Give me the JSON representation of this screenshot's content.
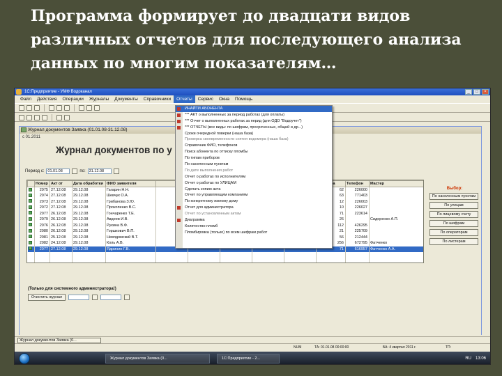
{
  "slide": {
    "title": "Программа формирует до двадцати видов\nразличных отчетов для последующего анализа\nданных по многим показателям…"
  },
  "app": {
    "title": "1С:Предприятие - УМФ Водоканал",
    "menu": [
      "Файл",
      "Действия",
      "Операции",
      "Журналы",
      "Документы",
      "Справочники",
      "Отчеты",
      "Сервис",
      "Окна",
      "Помощь"
    ],
    "active_menu_index": 6
  },
  "docwin": {
    "title": "Журнал документов Заявка (01.01.08-31.12.08)",
    "date": "с 01.2011",
    "heading": "Журнал документов по у",
    "period_label": "Период с:",
    "period_from": "01.01.08",
    "period_to_label": "по:",
    "period_to": "31.12.08"
  },
  "grid": {
    "columns": [
      "",
      "Номер",
      "Акт от",
      "Дата обработки",
      "ФИО заявителя",
      "",
      "",
      "",
      "",
      "",
      "Квартира",
      "Телефон",
      "Мастер"
    ],
    "rows": [
      [
        "2075",
        "27.12.08",
        "29.12.08",
        "Гагарин Н.Н.",
        "62",
        "226000",
        ""
      ],
      [
        "2074",
        "27.12.08",
        "29.12.08",
        "Шевчук О.А.",
        "63",
        "771403",
        ""
      ],
      [
        "2073",
        "27.12.08",
        "29.12.08",
        "Грибанова З.Ю.",
        "12",
        "226003",
        ""
      ],
      [
        "2072",
        "27.12.08",
        "29.12.08",
        "Прокопенко В.С.",
        "10",
        "226027",
        ""
      ],
      [
        "2077",
        "26.12.08",
        "29.12.08",
        "Гончаренко Т.Е.",
        "71",
        "223614",
        ""
      ],
      [
        "2079",
        "26.12.08",
        "29.12.08",
        "Авдеев И.В.",
        "26",
        "",
        "Сидоренко А.П."
      ],
      [
        "2076",
        "26.12.08",
        "29.12.08",
        "Рукина В.Ф.",
        "112",
        "426295",
        ""
      ],
      [
        "2080",
        "26.12.08",
        "29.12.08",
        "Горшкович В.П.",
        "21",
        "225709",
        ""
      ],
      [
        "2081",
        "25.12.08",
        "29.12.08",
        "Невядомский В.Т.",
        "56",
        "212444",
        ""
      ],
      [
        "2082",
        "24.12.08",
        "29.12.08",
        "Коль А.В.",
        "256",
        "672795",
        "Фатченко"
      ],
      [
        "2077",
        "27.12.08",
        "29.12.08",
        "Ядринин Г.В.",
        "71",
        "616957",
        "Фатченко А.А."
      ]
    ],
    "selected_row": 10
  },
  "side": {
    "label": "Выбор:",
    "buttons": [
      "По населенным пунктам",
      "По улицам",
      "По лицевому счету",
      "По шифрам",
      "По операторам",
      "По листерам"
    ]
  },
  "admin": {
    "label": "(Только для системного администратора!)",
    "clear_button": "Очистить журнал"
  },
  "reports_menu": {
    "items": [
      {
        "label": "ИНАЙТИ АБОНЕНТА",
        "icon": true
      },
      {
        "label": "*** АКТ о выполненных за период работах (для оплаты)",
        "icon": true
      },
      {
        "label": "*** Отчет о выполненных работах за перид (для ОДО \"Водоучет\")",
        "icon": true
      },
      {
        "label": "*** ОТЧЕТЫ (все виды: по шифрам, просроченные, общий и др...)",
        "icon": true
      },
      {
        "label": "Сроки очередной поверки (наша база)"
      },
      {
        "label": "Проверка своевременности снятия водомера (наша база)",
        "dim": true
      },
      {
        "label": "Справочник ФИО, телефонов"
      },
      {
        "label": "Поиск абонента по оттиску пломбы"
      },
      {
        "label": "По типам приборов"
      },
      {
        "label": "По населенным пунктам"
      },
      {
        "label": "По дате выполнения работ",
        "dim": true
      },
      {
        "label": "Отчет о работах по исполнителям"
      },
      {
        "label": "Отчет о работах по УЛИЦАМ"
      },
      {
        "label": "Сделать копию акта"
      },
      {
        "label": "Отчет по управляющим компаниям"
      },
      {
        "label": "По конкретному жилому дому"
      },
      {
        "label": "Отчет для администратора",
        "icon": true
      },
      {
        "label": "Отчет по установленным актам",
        "dim": true
      },
      {
        "label": "Диаграмма",
        "icon": true
      },
      {
        "label": "Количество пломб"
      },
      {
        "label": "Пломбировка (только) по всем шифрам работ"
      }
    ]
  },
  "docstrip": {
    "tab": "Журнал документов Заявка (0..."
  },
  "status": {
    "items": [
      "NUM",
      "ТА: 01.01.08 00:00:00",
      "БА: 4 квартал 2011 г.",
      "ТП:"
    ]
  },
  "taskbar": {
    "task1": "Журнал документов Заявка (0...",
    "task2": "1С:Предприятие - 2...",
    "lang": "RU",
    "clock": "13:06"
  }
}
